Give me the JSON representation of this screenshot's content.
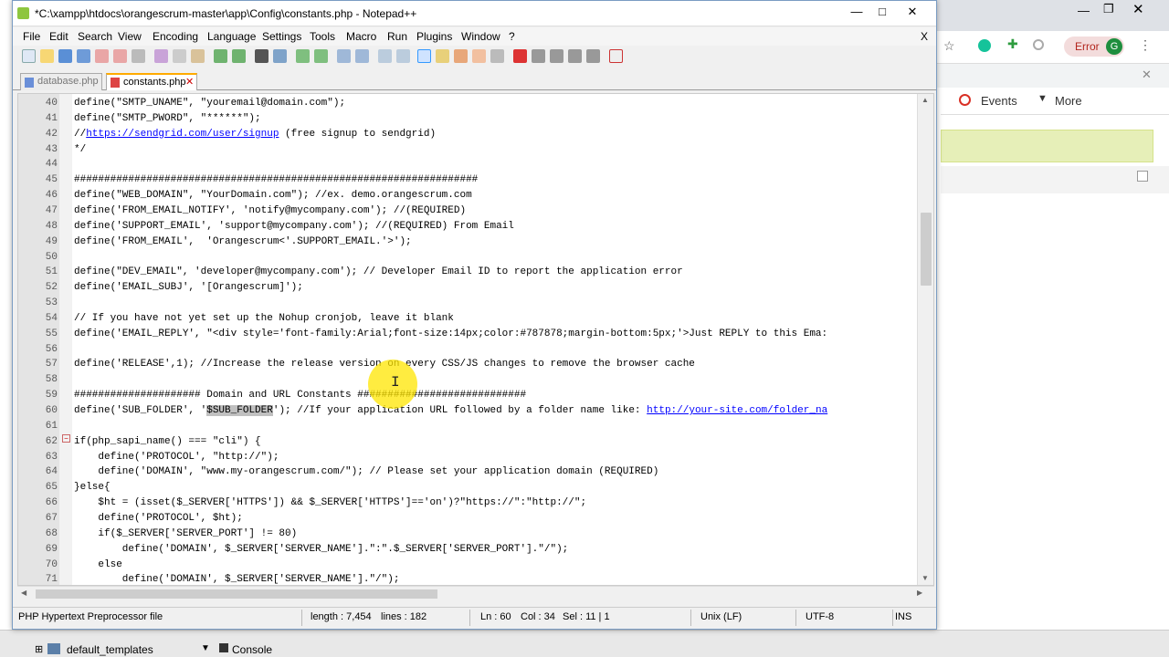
{
  "window": {
    "title": "*C:\\xampp\\htdocs\\orangescrum-master\\app\\Config\\constants.php - Notepad++",
    "minimize": "—",
    "maximize": "□",
    "close": "✕"
  },
  "menu": [
    "File",
    "Edit",
    "Search",
    "View",
    "Encoding",
    "Language",
    "Settings",
    "Tools",
    "Macro",
    "Run",
    "Plugins",
    "Window",
    "?"
  ],
  "menu_close": "X",
  "tabs": [
    {
      "label": "database.php",
      "active": false
    },
    {
      "label": "constants.php",
      "active": true
    }
  ],
  "lines": [
    {
      "n": "40",
      "t": "define(\"SMTP_UNAME\", \"youremail@domain.com\");"
    },
    {
      "n": "41",
      "t": "define(\"SMTP_PWORD\", \"******\");"
    },
    {
      "n": "42",
      "pre": "//",
      "link": "https://sendgrid.com/user/signup",
      "post": " (free signup to sendgrid)"
    },
    {
      "n": "43",
      "t": "*/"
    },
    {
      "n": "44",
      "t": ""
    },
    {
      "n": "45",
      "t": "###################################################################"
    },
    {
      "n": "46",
      "t": "define(\"WEB_DOMAIN\", \"YourDomain.com\"); //ex. demo.orangescrum.com"
    },
    {
      "n": "47",
      "t": "define('FROM_EMAIL_NOTIFY', 'notify@mycompany.com'); //(REQUIRED)"
    },
    {
      "n": "48",
      "t": "define('SUPPORT_EMAIL', 'support@mycompany.com'); //(REQUIRED) From Email"
    },
    {
      "n": "49",
      "t": "define('FROM_EMAIL',  'Orangescrum<'.SUPPORT_EMAIL.'>');"
    },
    {
      "n": "50",
      "t": ""
    },
    {
      "n": "51",
      "t": "define(\"DEV_EMAIL\", 'developer@mycompany.com'); // Developer Email ID to report the application error"
    },
    {
      "n": "52",
      "t": "define('EMAIL_SUBJ', '[Orangescrum]');"
    },
    {
      "n": "53",
      "t": ""
    },
    {
      "n": "54",
      "t": "// If you have not yet set up the Nohup cronjob, leave it blank"
    },
    {
      "n": "55",
      "t": "define('EMAIL_REPLY', \"<div style='font-family:Arial;font-size:14px;color:#787878;margin-bottom:5px;'>Just REPLY to this Ema:"
    },
    {
      "n": "56",
      "t": ""
    },
    {
      "n": "57",
      "t": "define('RELEASE',1); //Increase the release version on every CSS/JS changes to remove the browser cache"
    },
    {
      "n": "58",
      "t": ""
    },
    {
      "n": "59",
      "t": "##################### Domain and URL Constants ############################"
    },
    {
      "n": "60",
      "pre": "define('SUB_FOLDER', '",
      "sel": "$SUB_FOLDER",
      "mid": "'); //If your application URL followed by a folder name like: ",
      "link": "http://your-site.com/folder_na"
    },
    {
      "n": "61",
      "t": ""
    },
    {
      "n": "62",
      "t": "if(php_sapi_name() === \"cli\") {"
    },
    {
      "n": "63",
      "t": "    define('PROTOCOL', \"http://\");"
    },
    {
      "n": "64",
      "t": "    define('DOMAIN', \"www.my-orangescrum.com/\"); // Please set your application domain (REQUIRED)"
    },
    {
      "n": "65",
      "t": "}else{"
    },
    {
      "n": "66",
      "t": "    $ht = (isset($_SERVER['HTTPS']) && $_SERVER['HTTPS']=='on')?\"https://\":\"http://\";"
    },
    {
      "n": "67",
      "t": "    define('PROTOCOL', $ht);"
    },
    {
      "n": "68",
      "t": "    if($_SERVER['SERVER_PORT'] != 80)"
    },
    {
      "n": "69",
      "t": "        define('DOMAIN', $_SERVER['SERVER_NAME'].\":\".$_SERVER['SERVER_PORT'].\"/\");"
    },
    {
      "n": "70",
      "t": "    else"
    },
    {
      "n": "71",
      "t": "        define('DOMAIN', $_SERVER['SERVER_NAME'].\"/\");"
    }
  ],
  "status": {
    "filetype": "PHP Hypertext Preprocessor file",
    "length": "length : 7,454",
    "lines": "lines : 182",
    "ln": "Ln : 60",
    "col": "Col : 34",
    "sel": "Sel : 11 | 1",
    "eol": "Unix (LF)",
    "encoding": "UTF-8",
    "mode": "INS"
  },
  "browser": {
    "error_label": "Error",
    "avatar_letter": "G",
    "events_label": "Events",
    "more_label": "More"
  },
  "taskbar": {
    "item1": "default_templates",
    "item2": "Console"
  }
}
